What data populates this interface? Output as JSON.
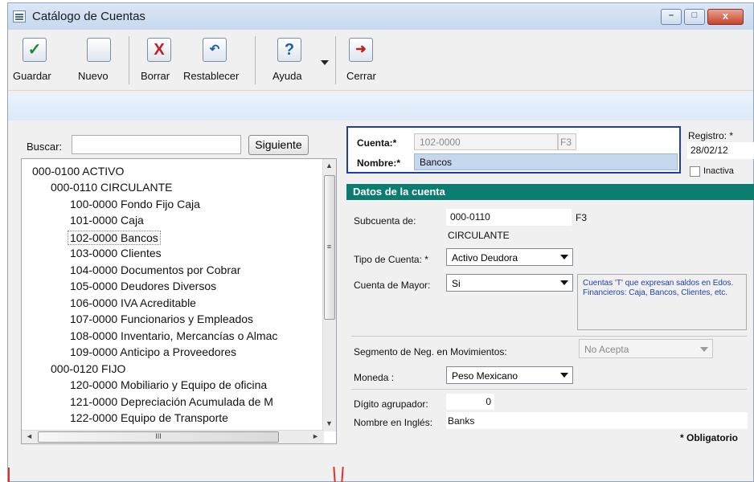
{
  "window": {
    "title": "Catálogo de Cuentas",
    "min": "–",
    "max": "□",
    "close": "x"
  },
  "toolbar": {
    "guardar": "Guardar",
    "nuevo": "Nuevo",
    "borrar": "Borrar",
    "restablecer": "Restablecer",
    "ayuda": "Ayuda",
    "cerrar": "Cerrar",
    "icons": {
      "guardar": "check-icon",
      "nuevo": "new-document-icon",
      "borrar": "x-icon",
      "restablecer": "undo-icon",
      "ayuda": "question-icon",
      "cerrar": "exit-icon"
    }
  },
  "search": {
    "label": "Buscar:",
    "value": "",
    "button": "Siguiente"
  },
  "tree": {
    "rows": [
      {
        "code": "000-0100 ACTIVO",
        "level": 0
      },
      {
        "code": "000-0110 CIRCULANTE",
        "level": 1
      },
      {
        "code": "100-0000 Fondo Fijo Caja",
        "level": 2
      },
      {
        "code": "101-0000 Caja",
        "level": 2
      },
      {
        "code": "102-0000 Bancos",
        "level": 2
      },
      {
        "code": "103-0000 Clientes",
        "level": 2
      },
      {
        "code": "104-0000 Documentos por Cobrar",
        "level": 2
      },
      {
        "code": "105-0000 Deudores Diversos",
        "level": 2
      },
      {
        "code": "106-0000 IVA Acreditable",
        "level": 2
      },
      {
        "code": "107-0000 Funcionarios y Empleados",
        "level": 2
      },
      {
        "code": "108-0000 Inventario, Mercancías o Almac",
        "level": 2
      },
      {
        "code": "109-0000 Anticipo a Proveedores",
        "level": 2
      },
      {
        "code": "000-0120 FIJO",
        "level": 1
      },
      {
        "code": "120-0000 Mobiliario y Equipo de oficina",
        "level": 2
      },
      {
        "code": "121-0000 Depreciación Acumulada de M",
        "level": 2
      },
      {
        "code": "122-0000 Equipo de Transporte",
        "level": 2
      }
    ],
    "selected": "102-0000 Bancos",
    "scroll": {
      "up": "▲",
      "down": "▼",
      "left": "◄",
      "right": "►",
      "grip_v": "≡",
      "grip_h": "III"
    }
  },
  "header": {
    "cuenta_label": "Cuenta:*",
    "cuenta_value": "102-0000",
    "cuenta_key": "F3",
    "nombre_label": "Nombre:*",
    "nombre_value": "Bancos",
    "registro_label": "Registro: *",
    "registro_value": "28/02/12",
    "inactiva_label": "Inactiva"
  },
  "details": {
    "section_title": "Datos de la cuenta",
    "subcuenta_label": "Subcuenta de:",
    "subcuenta_value": "000-0110",
    "subcuenta_key": "F3",
    "subcuenta_name": "CIRCULANTE",
    "tipo_label": "Tipo de Cuenta: *",
    "tipo_value": "Activo Deudora",
    "mayor_label": "Cuenta de Mayor:",
    "mayor_value": "Si",
    "mayor_note": "Cuentas 'T' que expresan saldos en Edos. Financieros: Caja, Bancos, Clientes, etc.",
    "segmento_label": "Segmento de Neg. en Movimientos:",
    "segmento_value": "No Acepta",
    "moneda_label": "Moneda :",
    "moneda_value": "Peso Mexicano",
    "digito_label": "Dígito agrupador:",
    "digito_value": "0",
    "ingles_label": "Nombre en Inglés:",
    "ingles_value": "Banks",
    "obligatorio": "* Obligatorio"
  },
  "colors": {
    "accent": "#0b7c70",
    "highlight_field": "#c6d8ee",
    "frame_border": "#1f3fa8"
  }
}
